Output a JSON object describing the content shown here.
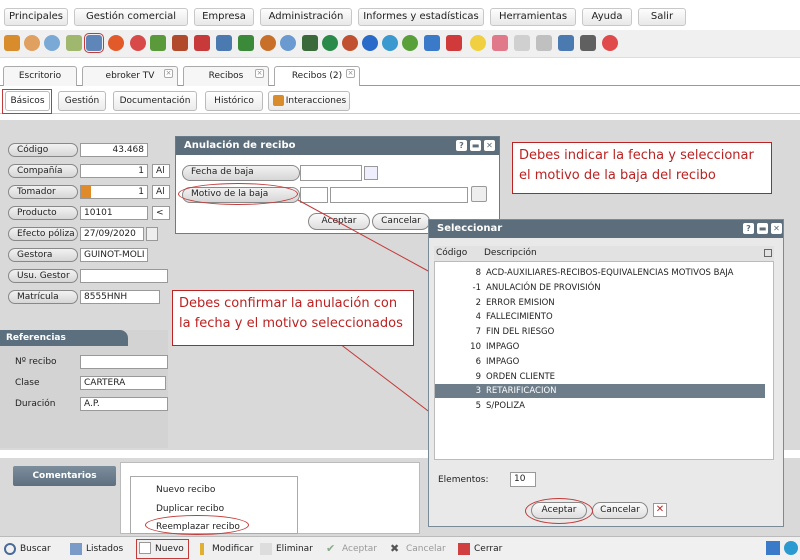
{
  "menu": [
    "Principales",
    "Gestión comercial",
    "Empresa",
    "Administración",
    "Informes y estadísticas",
    "Herramientas",
    "Ayuda",
    "Salir"
  ],
  "tabs": [
    "Escritorio",
    "ebroker TV",
    "Recibos",
    "Recibos (2)"
  ],
  "subtabs": [
    "Básicos",
    "Gestión",
    "Documentación",
    "Histórico",
    "Interacciones"
  ],
  "form": {
    "labels": [
      "Código",
      "Compañía",
      "Tomador",
      "Producto",
      "Efecto póliza",
      "Gestora",
      "Usu. Gestor",
      "Matrícula"
    ],
    "codigo": "43.468",
    "compania_num": "1",
    "compania_txt": "Al",
    "tomador_num": "1",
    "tomador_txt": "Al",
    "producto": "10101",
    "producto_suffix": "<",
    "efecto": "27/09/2020",
    "gestora": "GUINOT-MOLI",
    "matricula": "8555HNH"
  },
  "referencias": {
    "title": "Referencias",
    "labels": [
      "Nº recibo",
      "Clase",
      "Duración"
    ],
    "clase": "CARTERA",
    "duracion": "A.P."
  },
  "comentarios_label": "Comentarios",
  "nuevo_menu": [
    "Nuevo recibo",
    "Duplicar recibo",
    "Reemplazar recibo"
  ],
  "bottom": [
    "Buscar",
    "Listados",
    "Nuevo",
    "Modificar",
    "Eliminar",
    "Aceptar",
    "Cancelar",
    "Cerrar"
  ],
  "anulacion": {
    "title": "Anulación de recibo",
    "fecha_label": "Fecha de baja",
    "motivo_label": "Motivo de la baja",
    "aceptar": "Aceptar",
    "cancelar": "Cancelar"
  },
  "seleccionar": {
    "title": "Seleccionar",
    "col_codigo": "Código",
    "col_desc": "Descripción",
    "rows": [
      {
        "codigo": "8",
        "desc": "ACD-AUXILIARES-RECIBOS-EQUIVALENCIAS MOTIVOS BAJA"
      },
      {
        "codigo": "-1",
        "desc": "ANULACIÓN DE PROVISIÓN"
      },
      {
        "codigo": "2",
        "desc": "ERROR EMISION"
      },
      {
        "codigo": "4",
        "desc": "FALLECIMIENTO"
      },
      {
        "codigo": "7",
        "desc": "FIN DEL RIESGO"
      },
      {
        "codigo": "10",
        "desc": "IMPAGO"
      },
      {
        "codigo": "6",
        "desc": "IMPAGO"
      },
      {
        "codigo": "9",
        "desc": "ORDEN CLIENTE"
      },
      {
        "codigo": "3",
        "desc": "RETARIFICACION"
      },
      {
        "codigo": "5",
        "desc": "S/POLIZA"
      }
    ],
    "selected_index": 8,
    "elementos_label": "Elementos:",
    "elementos": "10",
    "aceptar": "Aceptar",
    "cancelar": "Cancelar"
  },
  "callouts": {
    "top": "Debes indicar la fecha y seleccionar el motivo de la baja del recibo",
    "middle": "Debes confirmar la anulación con la fecha y el motivo seleccionados"
  }
}
